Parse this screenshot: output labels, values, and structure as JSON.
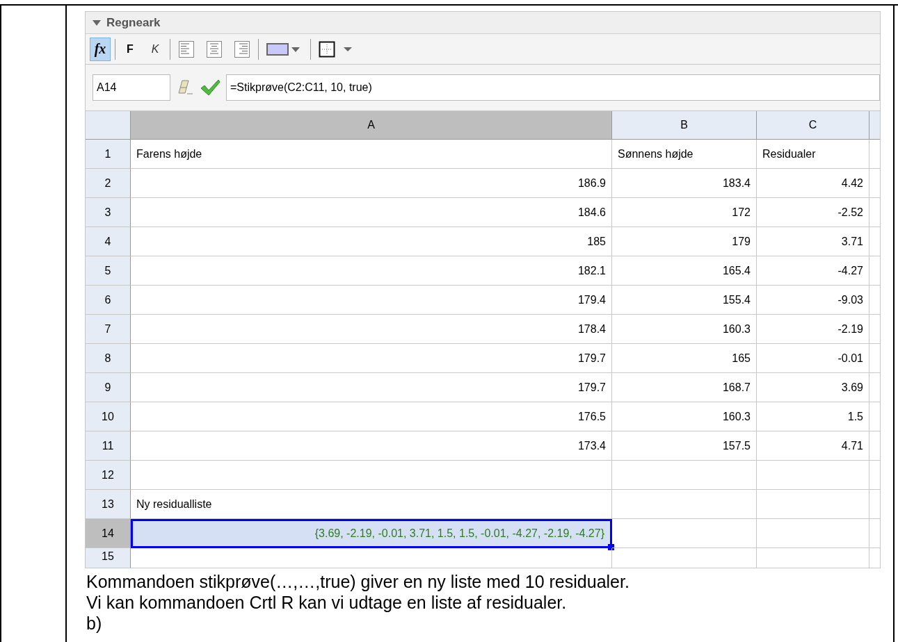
{
  "panel": {
    "title": "Regneark",
    "expanded": true
  },
  "toolbar": [
    {
      "kind": "fx",
      "label": "fx",
      "selected": true
    },
    {
      "kind": "bold",
      "label": "F",
      "selected": false
    },
    {
      "kind": "italic",
      "label": "K",
      "selected": false
    },
    {
      "kind": "align-left",
      "selected": false
    },
    {
      "kind": "align-center",
      "selected": false
    },
    {
      "kind": "align-right",
      "selected": false
    },
    {
      "kind": "bg-color"
    },
    {
      "kind": "border"
    }
  ],
  "input_bar": {
    "cell_name": "A14",
    "formula": "=Stikprøve(C2:C11, 10, true)"
  },
  "columns": [
    {
      "label": "A",
      "selected": true
    },
    {
      "label": "B",
      "selected": false
    },
    {
      "label": "C",
      "selected": false
    }
  ],
  "rows": [
    {
      "label": "1",
      "selected": false,
      "cells": [
        {
          "kind": "text",
          "value": "Farens højde"
        },
        {
          "kind": "text",
          "value": "Sønnens højde"
        },
        {
          "kind": "text",
          "value": "Residualer"
        }
      ]
    },
    {
      "label": "2",
      "selected": false,
      "cells": [
        {
          "kind": "number",
          "value": "186.9"
        },
        {
          "kind": "number",
          "value": "183.4"
        },
        {
          "kind": "number",
          "value": "4.42"
        }
      ]
    },
    {
      "label": "3",
      "selected": false,
      "cells": [
        {
          "kind": "number",
          "value": "184.6"
        },
        {
          "kind": "number",
          "value": "172"
        },
        {
          "kind": "number",
          "value": "-2.52"
        }
      ]
    },
    {
      "label": "4",
      "selected": false,
      "cells": [
        {
          "kind": "number",
          "value": "185"
        },
        {
          "kind": "number",
          "value": "179"
        },
        {
          "kind": "number",
          "value": "3.71"
        }
      ]
    },
    {
      "label": "5",
      "selected": false,
      "cells": [
        {
          "kind": "number",
          "value": "182.1"
        },
        {
          "kind": "number",
          "value": "165.4"
        },
        {
          "kind": "number",
          "value": "-4.27"
        }
      ]
    },
    {
      "label": "6",
      "selected": false,
      "cells": [
        {
          "kind": "number",
          "value": "179.4"
        },
        {
          "kind": "number",
          "value": "155.4"
        },
        {
          "kind": "number",
          "value": "-9.03"
        }
      ]
    },
    {
      "label": "7",
      "selected": false,
      "cells": [
        {
          "kind": "number",
          "value": "178.4"
        },
        {
          "kind": "number",
          "value": "160.3"
        },
        {
          "kind": "number",
          "value": "-2.19"
        }
      ]
    },
    {
      "label": "8",
      "selected": false,
      "cells": [
        {
          "kind": "number",
          "value": "179.7"
        },
        {
          "kind": "number",
          "value": "165"
        },
        {
          "kind": "number",
          "value": "-0.01"
        }
      ]
    },
    {
      "label": "9",
      "selected": false,
      "cells": [
        {
          "kind": "number",
          "value": "179.7"
        },
        {
          "kind": "number",
          "value": "168.7"
        },
        {
          "kind": "number",
          "value": "3.69"
        }
      ]
    },
    {
      "label": "10",
      "selected": false,
      "cells": [
        {
          "kind": "number",
          "value": "176.5"
        },
        {
          "kind": "number",
          "value": "160.3"
        },
        {
          "kind": "number",
          "value": "1.5"
        }
      ]
    },
    {
      "label": "11",
      "selected": false,
      "cells": [
        {
          "kind": "number",
          "value": "173.4"
        },
        {
          "kind": "number",
          "value": "157.5"
        },
        {
          "kind": "number",
          "value": "4.71"
        }
      ]
    },
    {
      "label": "12",
      "selected": false
    },
    {
      "label": "13",
      "selected": false,
      "cells": [
        {
          "kind": "text",
          "value": "Ny residualliste"
        }
      ]
    },
    {
      "label": "14",
      "selected": true,
      "cells": [
        {
          "kind": "list",
          "value": "{3.69, -2.19, -0.01, 3.71, 1.5, 1.5, -0.01, -4.27, -2.19, -4.27}"
        }
      ]
    },
    {
      "label": "15",
      "selected": false
    }
  ],
  "paragraphs": [
    "Kommandoen stikprøve(…,…,true) giver en ny liste med 10 residualer.",
    "Vi kan kommandoen Crtl R kan vi udtage en liste af residualer.",
    "b)"
  ]
}
